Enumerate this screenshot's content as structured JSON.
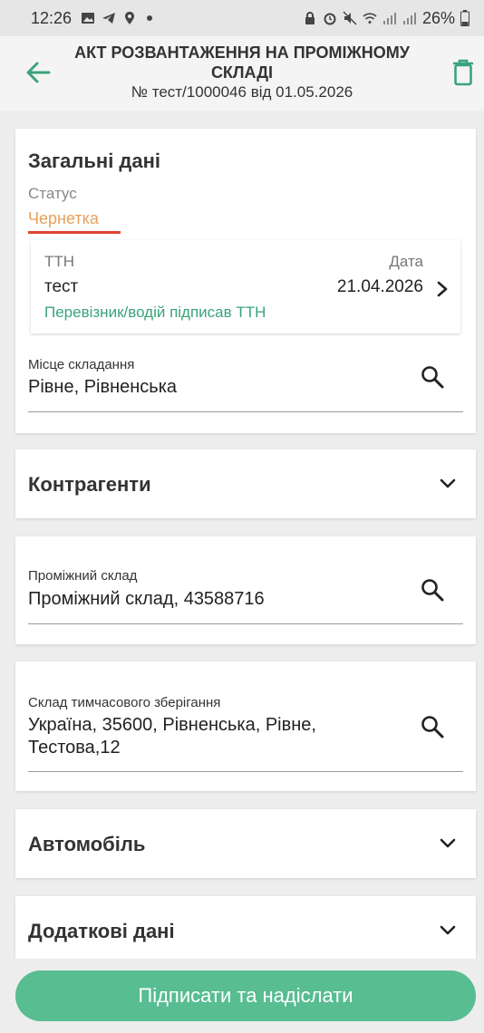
{
  "statusbar": {
    "time": "12:26",
    "battery": "26%"
  },
  "header": {
    "title": "АКТ РОЗВАНТАЖЕННЯ НА ПРОМІЖНОМУ СКЛАДІ",
    "subtitle": "№ тест/1000046 від 01.05.2026"
  },
  "general": {
    "title": "Загальні дані",
    "status_label": "Статус",
    "status_value": "Чернетка",
    "ttn": {
      "label": "ТТН",
      "value": "тест",
      "date_label": "Дата",
      "date_value": "21.04.2026",
      "note": "Перевізник/водій підписав ТТН"
    },
    "place_label": "Місце складання",
    "place_value": "Рівне, Рівненська"
  },
  "counterparties": {
    "title": "Контрагенти"
  },
  "intermediate": {
    "label": "Проміжний склад",
    "value": "Проміжний склад, 43588716"
  },
  "temp_storage": {
    "label": "Склад тимчасового зберігання",
    "value": "Україна, 35600, Рівненська, Рівне, Тестова,12"
  },
  "vehicle": {
    "title": "Автомобіль"
  },
  "additional": {
    "title": "Додаткові дані"
  },
  "submit_label": "Підписати та надіслати",
  "colors": {
    "accent": "#58bd91",
    "green_text": "#3aa37a",
    "draft": "#e8a05a",
    "underline": "#e0452f"
  },
  "icons": [
    "arrow-left-icon",
    "trash-icon",
    "search-icon",
    "chevron-right-icon",
    "chevron-down-icon"
  ]
}
